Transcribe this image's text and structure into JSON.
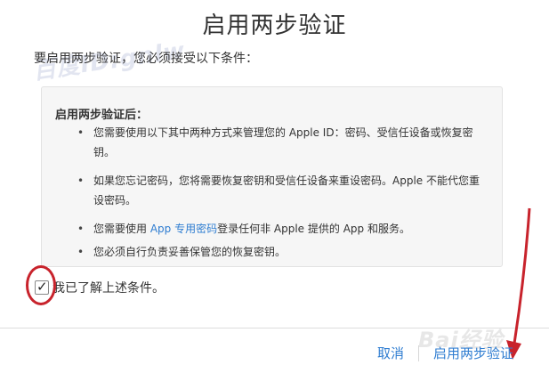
{
  "page": {
    "title": "启用两步验证",
    "intro": "要启用两步验证，您必须接受以下条件："
  },
  "conditions": {
    "heading": "启用两步验证后：",
    "items": [
      "您需要使用以下其中两种方式来管理您的 Apple ID：密码、受信任设备或恢复密钥。",
      "如果您忘记密码，您将需要恢复密钥和受信任设备来重设密码。Apple 不能代您重设密码。",
      {
        "before": "您需要使用 ",
        "link": "App 专用密码",
        "after": "登录任何非 Apple 提供的 App 和服务。"
      },
      "您必须自行负责妥善保管您的恢复密钥。"
    ]
  },
  "agreement": {
    "label": "我已了解上述条件。",
    "checked": true
  },
  "footer": {
    "cancel_label": "取消",
    "enable_label": "启用两步验证"
  },
  "watermarks": {
    "top": "百度ID:gnlw",
    "bottom": "Bai经验"
  },
  "colors": {
    "link": "#2f7dd1",
    "annotation_red": "#c8232c",
    "box_background": "#f6f6f6"
  }
}
